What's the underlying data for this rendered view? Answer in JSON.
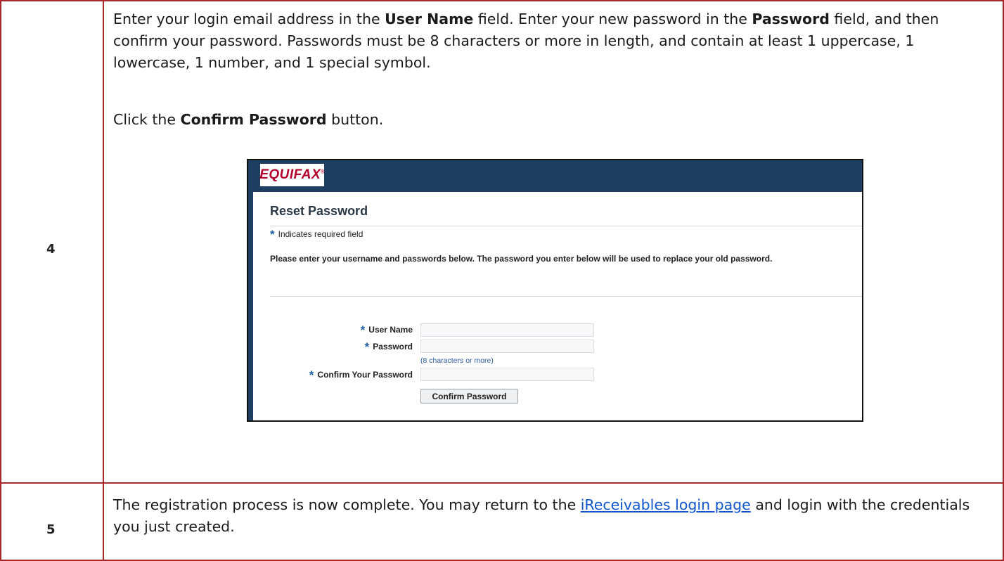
{
  "rows": [
    {
      "step": "4",
      "instructions": {
        "p1_a": "Enter your login email address in the ",
        "p1_b": "User Name",
        "p1_c": " field.  Enter your new password in the ",
        "p1_d": "Password",
        "p1_e": " field, and then confirm your password.  Passwords must be 8 characters or more in length, and contain at least 1 uppercase, 1 lowercase, 1 number, and 1 special symbol.",
        "p2_a": "Click the ",
        "p2_b": "Confirm Password",
        "p2_c": " button."
      }
    },
    {
      "step": "5",
      "text_a": "The registration process is now complete.   You may return to the ",
      "link": "iReceivables login page",
      "text_b": " and login with the credentials you just created."
    }
  ],
  "screenshot": {
    "logo": "EQUIFAX",
    "logo_mark": "®",
    "title": "Reset Password",
    "required_star": "*",
    "required_note": "Indicates required field",
    "instruction": "Please enter your username and passwords below. The password you enter below will be used to replace your old password.",
    "fields": {
      "username_label": "User Name",
      "password_label": "Password",
      "password_hint": "(8 characters or more)",
      "confirm_label": "Confirm Your Password"
    },
    "button": "Confirm Password"
  },
  "colors": {
    "border": "#a52a2a",
    "header_bg": "#1e3f61",
    "logo": "#b3002d",
    "link": "#1155cc"
  }
}
